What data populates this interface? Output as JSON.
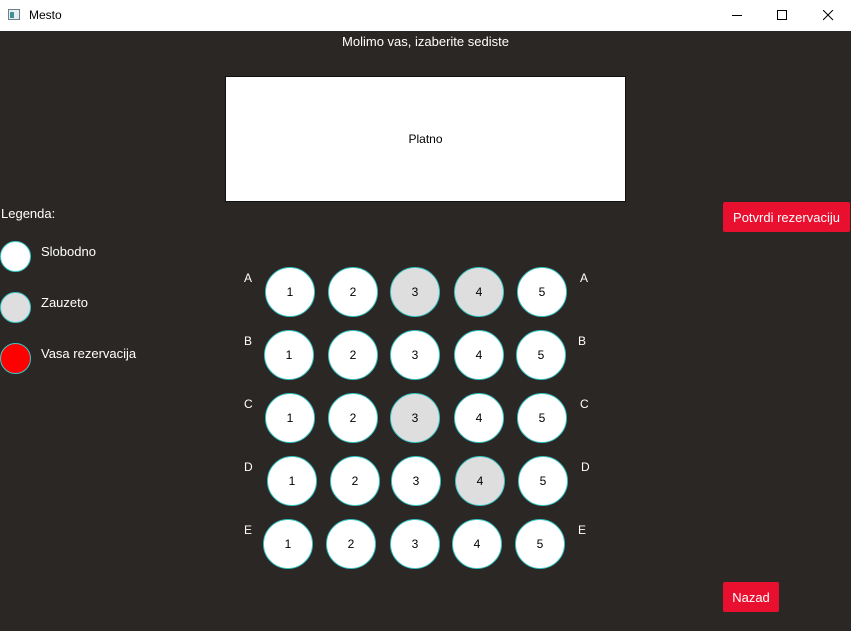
{
  "window": {
    "title": "Mesto"
  },
  "prompt": "Molimo vas, izaberite sediste",
  "screen_label": "Platno",
  "legend": {
    "title": "Legenda:",
    "items": [
      {
        "label": "Slobodno",
        "color": "#ffffff"
      },
      {
        "label": "Zauzeto",
        "color": "#dedede"
      },
      {
        "label": "Vasa rezervacija",
        "color": "#ff0000"
      }
    ]
  },
  "buttons": {
    "confirm": "Potvrdi rezervaciju",
    "back": "Nazad"
  },
  "colors": {
    "background": "#2b2724",
    "accent": "#e8102e",
    "free": "#ffffff",
    "taken": "#dedede",
    "reserved": "#ff0000",
    "seat_border": "#35c5c5"
  },
  "rows": [
    {
      "label": "A",
      "seats": [
        {
          "number": "1",
          "status": "free"
        },
        {
          "number": "2",
          "status": "free"
        },
        {
          "number": "3",
          "status": "taken"
        },
        {
          "number": "4",
          "status": "taken"
        },
        {
          "number": "5",
          "status": "free"
        }
      ]
    },
    {
      "label": "B",
      "seats": [
        {
          "number": "1",
          "status": "free"
        },
        {
          "number": "2",
          "status": "free"
        },
        {
          "number": "3",
          "status": "free"
        },
        {
          "number": "4",
          "status": "free"
        },
        {
          "number": "5",
          "status": "free"
        }
      ]
    },
    {
      "label": "C",
      "seats": [
        {
          "number": "1",
          "status": "free"
        },
        {
          "number": "2",
          "status": "free"
        },
        {
          "number": "3",
          "status": "taken"
        },
        {
          "number": "4",
          "status": "free"
        },
        {
          "number": "5",
          "status": "free"
        }
      ]
    },
    {
      "label": "D",
      "seats": [
        {
          "number": "1",
          "status": "free"
        },
        {
          "number": "2",
          "status": "free"
        },
        {
          "number": "3",
          "status": "free"
        },
        {
          "number": "4",
          "status": "taken"
        },
        {
          "number": "5",
          "status": "free"
        }
      ]
    },
    {
      "label": "E",
      "seats": [
        {
          "number": "1",
          "status": "free"
        },
        {
          "number": "2",
          "status": "free"
        },
        {
          "number": "3",
          "status": "free"
        },
        {
          "number": "4",
          "status": "free"
        },
        {
          "number": "5",
          "status": "free"
        }
      ]
    }
  ]
}
